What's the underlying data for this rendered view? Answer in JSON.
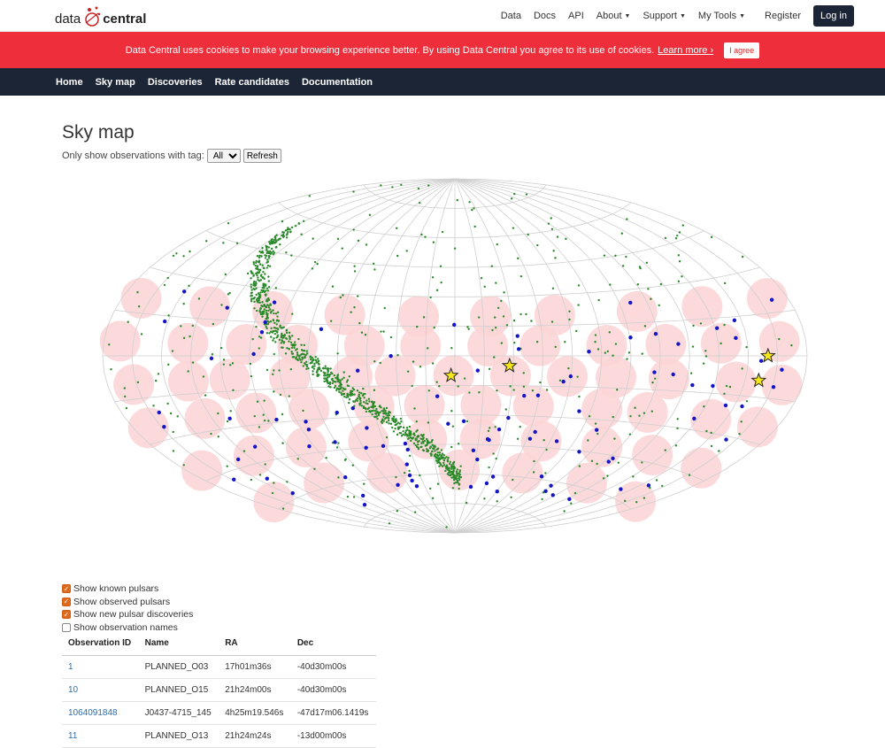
{
  "header": {
    "logo_left": "data",
    "logo_right": "central",
    "nav": [
      {
        "label": "Data",
        "caret": false
      },
      {
        "label": "Docs",
        "caret": false
      },
      {
        "label": "API",
        "caret": false
      },
      {
        "label": "About",
        "caret": true
      },
      {
        "label": "Support",
        "caret": true
      },
      {
        "label": "My Tools",
        "caret": true
      }
    ],
    "register": "Register",
    "login": "Log in"
  },
  "cookie": {
    "message": "Data Central uses cookies to make your browsing experience better. By using Data Central you agree to its use of cookies.",
    "learn_more": "Learn more ›",
    "agree": "I agree"
  },
  "mainnav": [
    "Home",
    "Sky map",
    "Discoveries",
    "Rate candidates",
    "Documentation"
  ],
  "page": {
    "title": "Sky map",
    "filter_label": "Only show observations with tag:",
    "filter_value": "All",
    "refresh": "Refresh"
  },
  "skymap": {
    "projection": "aitoff",
    "colors": {
      "grid": "#cfcfcf",
      "beam": "#fbd3d5",
      "known_pulsar": "#2a8a2a",
      "observed_pulsar": "#1515c8",
      "discovery": "#f5e61a"
    }
  },
  "options": [
    {
      "label": "Show known pulsars",
      "checked": true
    },
    {
      "label": "Show observed pulsars",
      "checked": true
    },
    {
      "label": "Show new pulsar discoveries",
      "checked": true
    },
    {
      "label": "Show observation names",
      "checked": false
    }
  ],
  "table": {
    "headers": [
      "Observation ID",
      "Name",
      "RA",
      "Dec"
    ],
    "rows": [
      [
        "1",
        "PLANNED_O03",
        "17h01m36s",
        "-40d30m00s"
      ],
      [
        "10",
        "PLANNED_O15",
        "21h24m00s",
        "-40d30m00s"
      ],
      [
        "1064091848",
        "J0437-4715_145",
        "4h25m19.546s",
        "-47d17m06.1419s"
      ],
      [
        "11",
        "PLANNED_O13",
        "21h24m24s",
        "-13d00m00s"
      ]
    ]
  }
}
